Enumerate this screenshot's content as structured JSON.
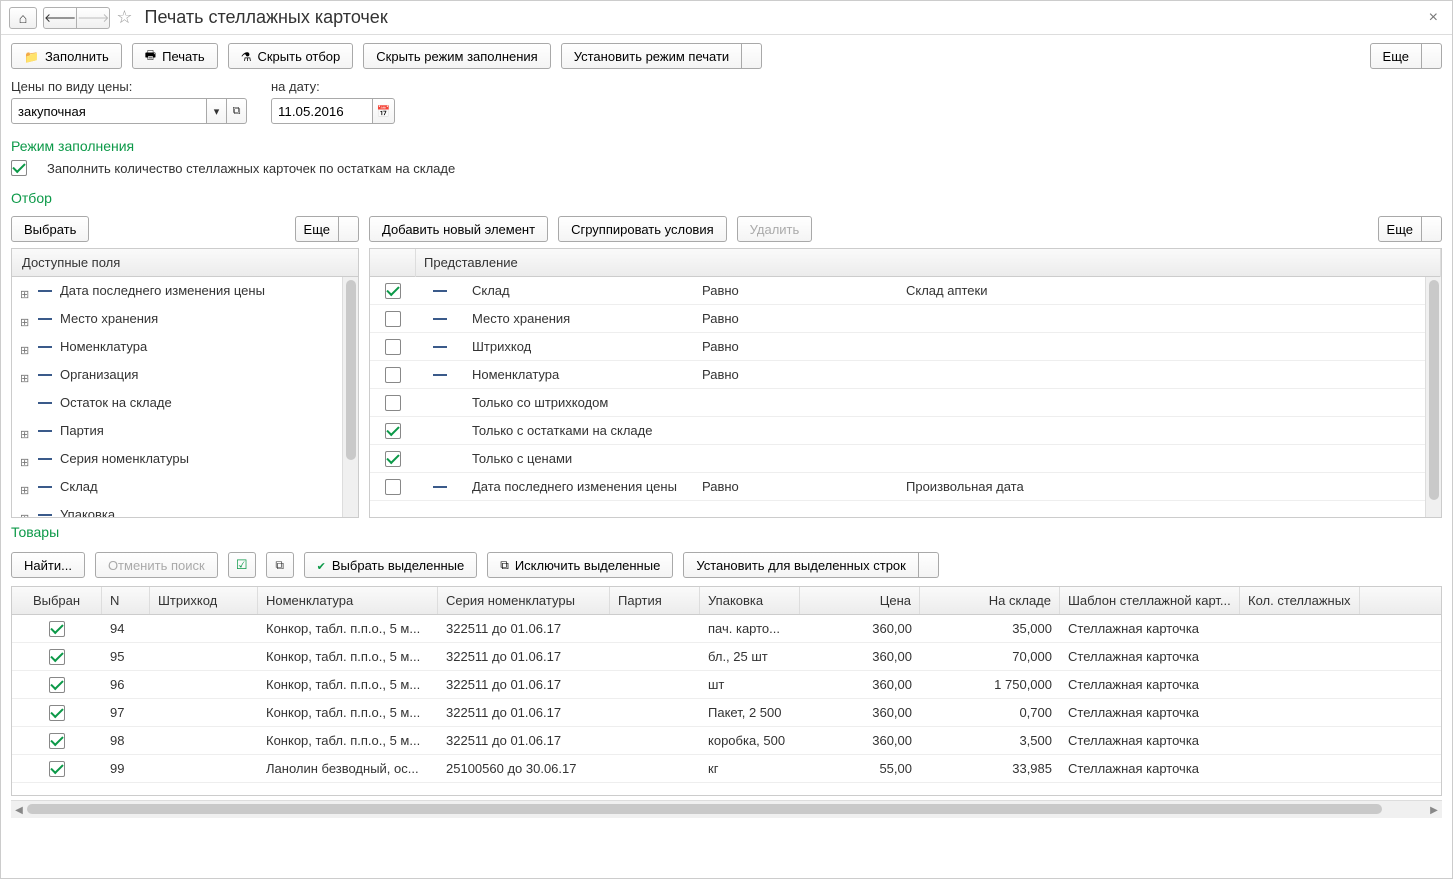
{
  "titlebar": {
    "title": "Печать стеллажных карточек"
  },
  "toolbar": {
    "fill": "Заполнить",
    "print": "Печать",
    "hide_filter": "Скрыть отбор",
    "hide_fill_mode": "Скрыть режим заполнения",
    "set_print_mode": "Установить режим печати",
    "more": "Еще"
  },
  "form": {
    "price_type_label": "Цены по виду цены:",
    "price_type_value": "закупочная",
    "date_label": "на дату:",
    "date_value": "11.05.2016"
  },
  "fill_mode": {
    "title": "Режим заполнения",
    "checkbox_label": "Заполнить количество стеллажных карточек по остаткам на складе"
  },
  "filter": {
    "title": "Отбор",
    "select_btn": "Выбрать",
    "more_left": "Еще",
    "add_btn": "Добавить новый элемент",
    "group_btn": "Сгруппировать условия",
    "delete_btn": "Удалить",
    "more_right": "Еще",
    "available_header": "Доступные поля",
    "available_fields": [
      {
        "expand": true,
        "label": "Дата последнего изменения цены"
      },
      {
        "expand": true,
        "label": "Место хранения"
      },
      {
        "expand": true,
        "label": "Номенклатура"
      },
      {
        "expand": true,
        "label": "Организация"
      },
      {
        "expand": false,
        "label": "Остаток на складе"
      },
      {
        "expand": true,
        "label": "Партия"
      },
      {
        "expand": true,
        "label": "Серия номенклатуры"
      },
      {
        "expand": true,
        "label": "Склад"
      },
      {
        "expand": true,
        "label": "Упаковка"
      }
    ],
    "repr_header": "Представление",
    "conditions": [
      {
        "checked": true,
        "dash": true,
        "name": "Склад",
        "op": "Равно",
        "value": "Склад аптеки"
      },
      {
        "checked": false,
        "dash": true,
        "name": "Место хранения",
        "op": "Равно",
        "value": ""
      },
      {
        "checked": false,
        "dash": true,
        "name": "Штрихкод",
        "op": "Равно",
        "value": ""
      },
      {
        "checked": false,
        "dash": true,
        "name": "Номенклатура",
        "op": "Равно",
        "value": ""
      },
      {
        "checked": false,
        "dash": false,
        "name": "Только со штрихкодом",
        "op": "",
        "value": ""
      },
      {
        "checked": true,
        "dash": false,
        "name": "Только с остатками на складе",
        "op": "",
        "value": ""
      },
      {
        "checked": true,
        "dash": false,
        "name": "Только с ценами",
        "op": "",
        "value": ""
      },
      {
        "checked": false,
        "dash": true,
        "name": "Дата последнего изменения цены",
        "op": "Равно",
        "value": "Произвольная дата"
      }
    ]
  },
  "products": {
    "title": "Товары",
    "find_btn": "Найти...",
    "cancel_find_btn": "Отменить поиск",
    "select_marked_btn": "Выбрать выделенные",
    "exclude_marked_btn": "Исключить выделенные",
    "set_for_marked_btn": "Установить для выделенных строк",
    "columns": {
      "selected": "Выбран",
      "n": "N",
      "barcode": "Штрихкод",
      "nomenclature": "Номенклатура",
      "series": "Серия номенклатуры",
      "party": "Партия",
      "package": "Упаковка",
      "price": "Цена",
      "in_stock": "На складе",
      "template": "Шаблон стеллажной карт...",
      "qty": "Кол. стеллажных"
    },
    "rows": [
      {
        "sel": true,
        "n": "94",
        "bar": "",
        "nom": "Конкор, табл. п.п.о., 5 м...",
        "ser": "322511 до 01.06.17",
        "par": "",
        "pack": "пач. карто...",
        "price": "360,00",
        "stock": "35,000",
        "tpl": "Стеллажная карточка",
        "qty": ""
      },
      {
        "sel": true,
        "n": "95",
        "bar": "",
        "nom": "Конкор, табл. п.п.о., 5 м...",
        "ser": "322511 до 01.06.17",
        "par": "",
        "pack": "бл., 25 шт",
        "price": "360,00",
        "stock": "70,000",
        "tpl": "Стеллажная карточка",
        "qty": ""
      },
      {
        "sel": true,
        "n": "96",
        "bar": "",
        "nom": "Конкор, табл. п.п.о., 5 м...",
        "ser": "322511 до 01.06.17",
        "par": "",
        "pack": "шт",
        "price": "360,00",
        "stock": "1 750,000",
        "tpl": "Стеллажная карточка",
        "qty": ""
      },
      {
        "sel": true,
        "n": "97",
        "bar": "",
        "nom": "Конкор, табл. п.п.о., 5 м...",
        "ser": "322511 до 01.06.17",
        "par": "",
        "pack": "Пакет, 2 500",
        "price": "360,00",
        "stock": "0,700",
        "tpl": "Стеллажная карточка",
        "qty": ""
      },
      {
        "sel": true,
        "n": "98",
        "bar": "",
        "nom": "Конкор, табл. п.п.о., 5 м...",
        "ser": "322511 до 01.06.17",
        "par": "",
        "pack": "коробка, 500",
        "price": "360,00",
        "stock": "3,500",
        "tpl": "Стеллажная карточка",
        "qty": ""
      },
      {
        "sel": true,
        "n": "99",
        "bar": "",
        "nom": "Ланолин безводный, ос...",
        "ser": "25100560 до 30.06.17",
        "par": "",
        "pack": "кг",
        "price": "55,00",
        "stock": "33,985",
        "tpl": "Стеллажная карточка",
        "qty": ""
      }
    ]
  }
}
